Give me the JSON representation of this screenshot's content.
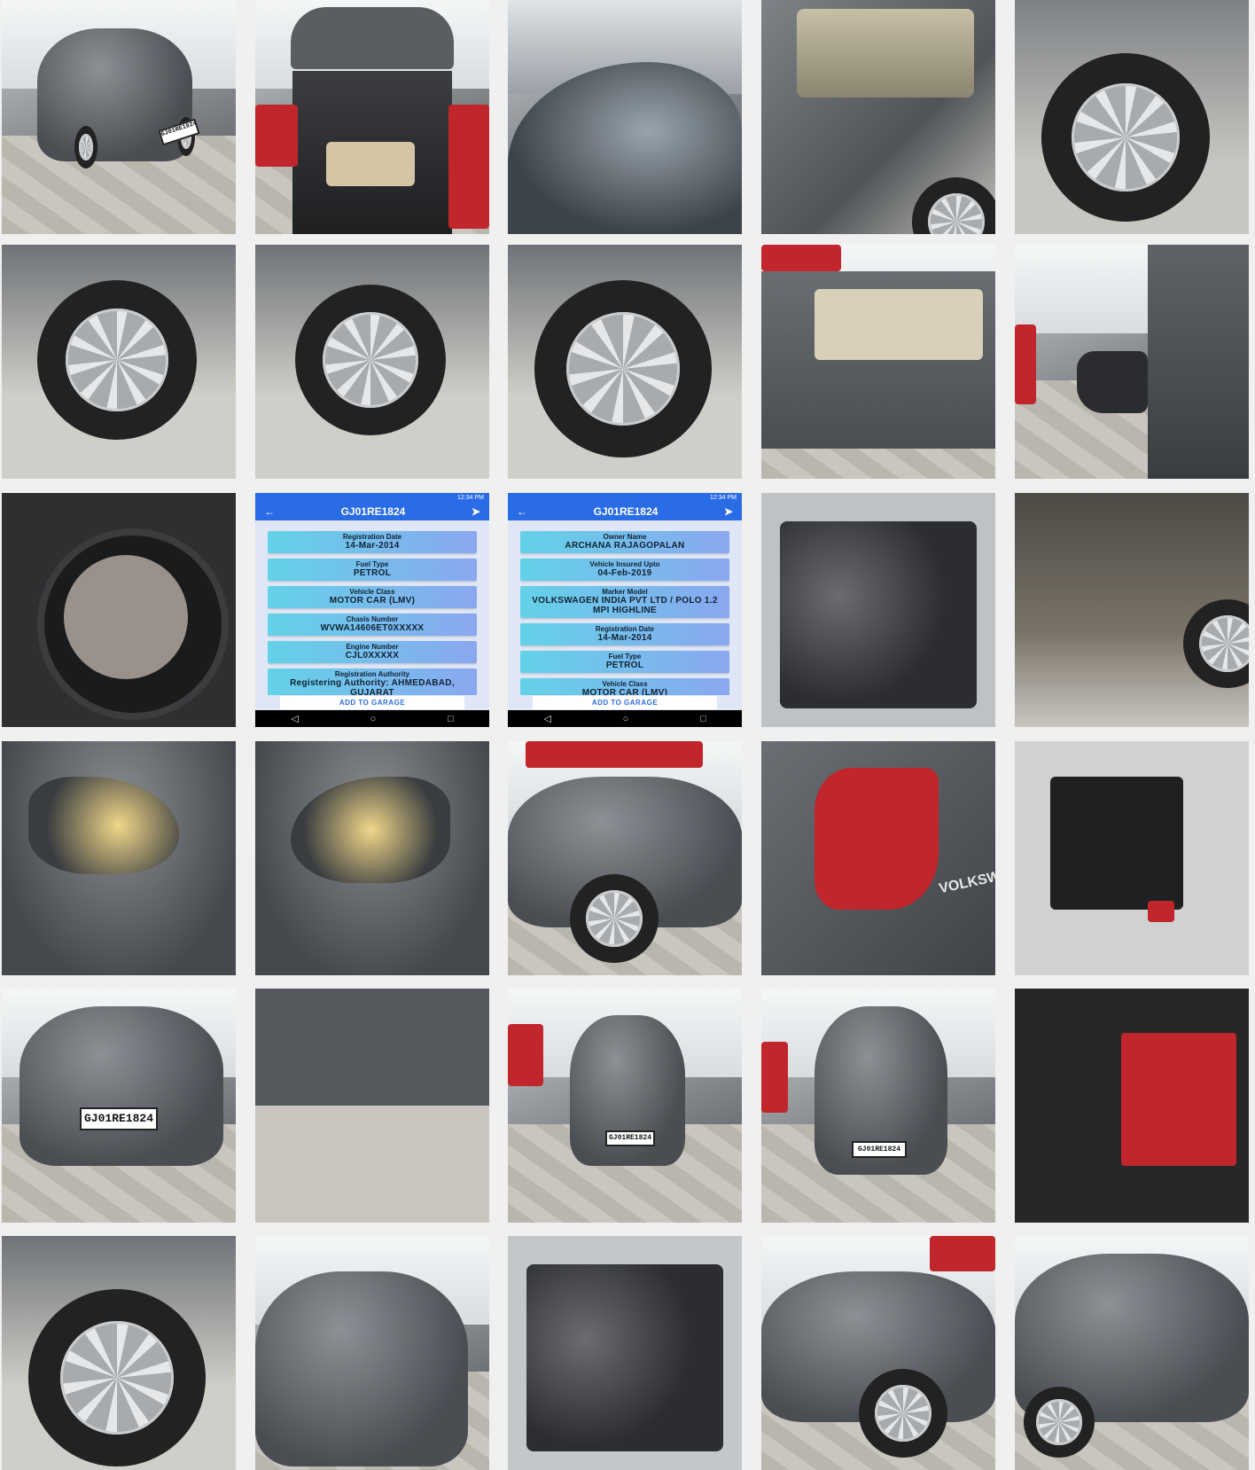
{
  "gallery": {
    "phone1": {
      "status_right": "12:34 PM",
      "title": "GJ01RE1824",
      "cards": [
        {
          "k": "Registration Date",
          "v": "14-Mar-2014"
        },
        {
          "k": "Fuel Type",
          "v": "PETROL"
        },
        {
          "k": "Vehicle Class",
          "v": "MOTOR CAR (LMV)"
        },
        {
          "k": "Chasis Number",
          "v": "WVWA14606ET0XXXXX"
        },
        {
          "k": "Engine Number",
          "v": "CJL0XXXXX"
        },
        {
          "k": "Registration Authority",
          "v": "Registering Authority: AHMEDABAD, GUJARAT"
        }
      ],
      "add_button": "ADD TO GARAGE"
    },
    "phone2": {
      "status_right": "12:34 PM",
      "title": "GJ01RE1824",
      "cards": [
        {
          "k": "Owner Name",
          "v": "ARCHANA RAJAGOPALAN"
        },
        {
          "k": "Vehicle Insured Upto",
          "v": "04-Feb-2019"
        },
        {
          "k": "Marker Model",
          "v": "VOLKSWAGEN INDIA PVT LTD / POLO 1.2 MPI HIGHLINE"
        },
        {
          "k": "Registration Date",
          "v": "14-Mar-2014"
        },
        {
          "k": "Fuel Type",
          "v": "PETROL"
        },
        {
          "k": "Vehicle Class",
          "v": "MOTOR CAR (LMV)"
        }
      ],
      "add_button": "ADD TO GARAGE"
    },
    "plates": {
      "front": "GJ01RE1824",
      "front_small": "GJ01RE1824",
      "badge": "VOLKSWA"
    }
  }
}
